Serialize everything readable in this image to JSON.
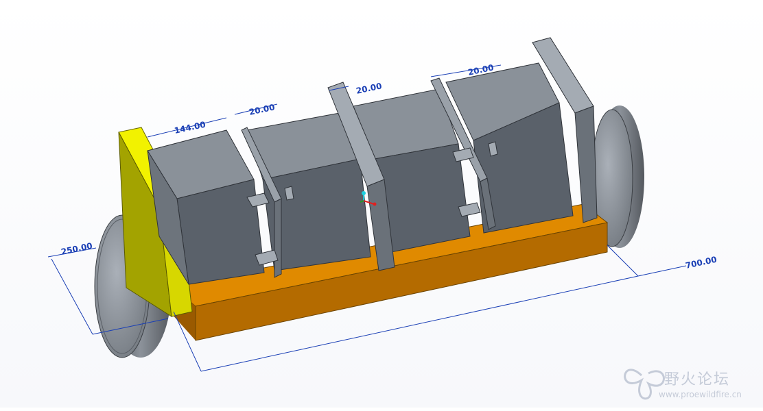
{
  "dimensions": {
    "d144": "144.00",
    "d20_a": "20.00",
    "d20_b": "20.00",
    "d20_c": "20.00",
    "d250": "250.00",
    "d700": "700.00"
  },
  "watermark": {
    "name": "野火论坛",
    "url": "www.proewildfire.cn"
  },
  "colors": {
    "dimension": "#1a3fb5",
    "base": "#e08a00",
    "end_plate": "#e8e800",
    "body": "#5a616a"
  }
}
